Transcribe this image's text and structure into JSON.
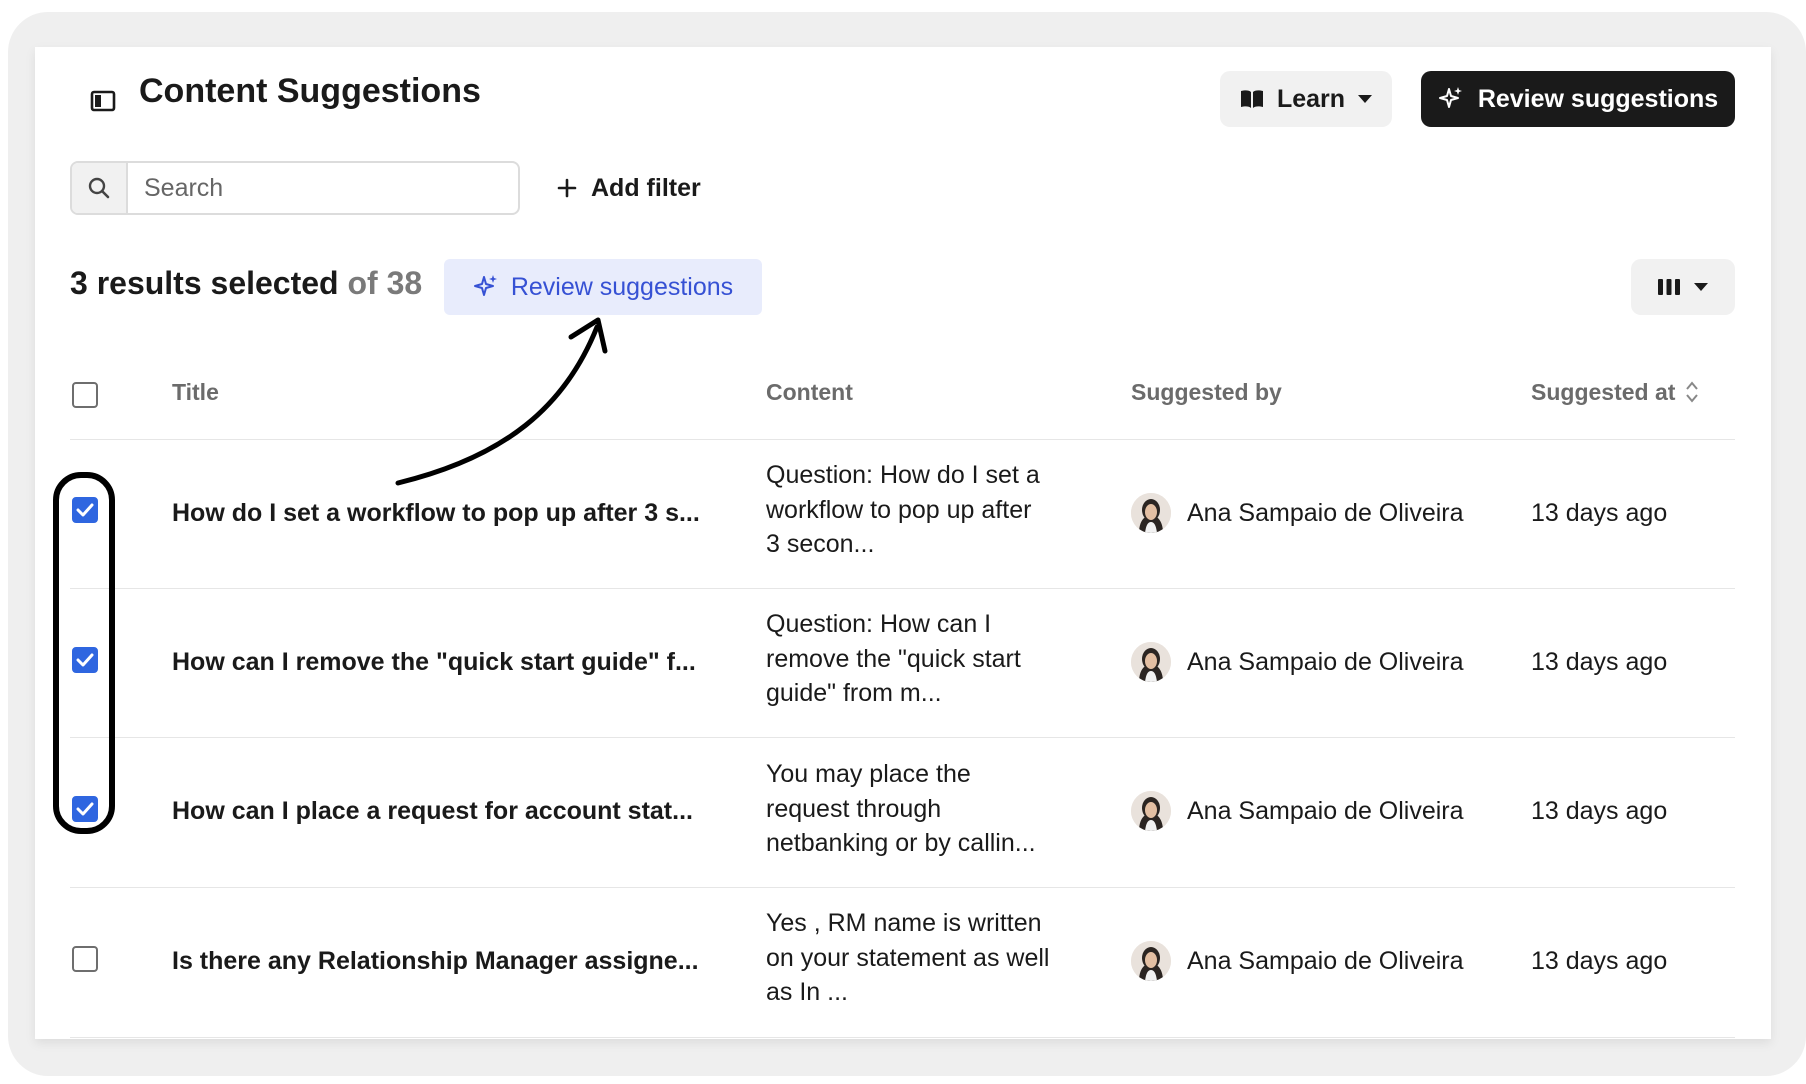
{
  "header": {
    "title": "Content Suggestions",
    "learn_label": "Learn",
    "review_label": "Review suggestions"
  },
  "search": {
    "placeholder": "Search",
    "value": ""
  },
  "filters": {
    "add_label": "Add filter"
  },
  "selection": {
    "selected_text": "3 results selected",
    "total_text": "of 38",
    "review_label": "Review suggestions"
  },
  "table": {
    "columns": [
      "Title",
      "Content",
      "Suggested by",
      "Suggested at"
    ],
    "rows": [
      {
        "checked": true,
        "title": "How do I set a workflow to pop up after 3 s...",
        "content_lines": [
          "Question: How do I set a",
          "workflow to pop up after",
          "3 secon..."
        ],
        "suggested_by": "Ana Sampaio de Oliveira",
        "suggested_at": "13 days ago"
      },
      {
        "checked": true,
        "title": "How can I remove the \"quick start guide\" f...",
        "content_lines": [
          "Question: How can I",
          "remove the \"quick start",
          "guide\" from m..."
        ],
        "suggested_by": "Ana Sampaio de Oliveira",
        "suggested_at": "13 days ago"
      },
      {
        "checked": true,
        "title": "How can I place a request for account stat...",
        "content_lines": [
          "You may place the",
          "request through",
          "netbanking or by callin..."
        ],
        "suggested_by": "Ana Sampaio de Oliveira",
        "suggested_at": "13 days ago"
      },
      {
        "checked": false,
        "title": "Is there any Relationship Manager assigne...",
        "content_lines": [
          "Yes , RM name is written",
          "on your statement as well",
          "as In ..."
        ],
        "suggested_by": "Ana Sampaio de Oliveira",
        "suggested_at": "13 days ago"
      }
    ]
  },
  "icons": {
    "sidebar_toggle": "sidebar-toggle-icon",
    "learn": "book-icon",
    "review": "sparkle-icon",
    "search": "search-icon",
    "add_filter": "plus-icon",
    "columns": "columns-icon",
    "sort": "sort-icon",
    "dropdown": "caret-down-icon"
  },
  "colors": {
    "primary_dark": "#1a1a1a",
    "accent_blue": "#3651d4",
    "accent_blue_bg": "#e8ecfc",
    "checkbox_checked": "#2f66e0"
  }
}
